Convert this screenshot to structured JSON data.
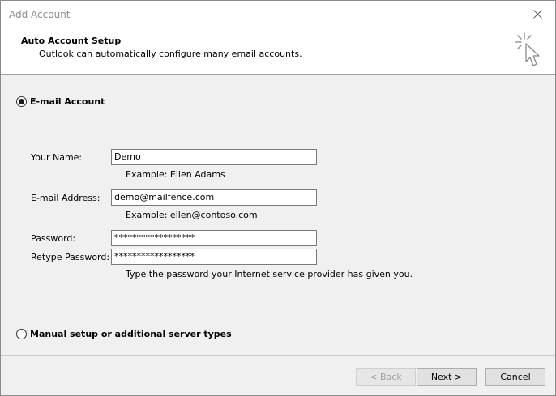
{
  "window": {
    "title": "Add Account"
  },
  "header": {
    "title": "Auto Account Setup",
    "subtitle": "Outlook can automatically configure many email accounts."
  },
  "options": {
    "email_account": {
      "label": "E-mail Account",
      "selected": true
    },
    "manual_setup": {
      "label": "Manual setup or additional server types",
      "selected": false
    }
  },
  "form": {
    "name": {
      "label": "Your Name:",
      "value": "Demo",
      "hint": "Example: Ellen Adams"
    },
    "email": {
      "label": "E-mail Address:",
      "value": "demo@mailfence.com",
      "hint": "Example: ellen@contoso.com"
    },
    "password": {
      "label": "Password:",
      "value": "******************"
    },
    "retype": {
      "label": "Retype Password:",
      "value": "******************"
    },
    "password_hint": "Type the password your Internet service provider has given you."
  },
  "buttons": {
    "back": "< Back",
    "next": "Next >",
    "cancel": "Cancel"
  },
  "icons": {
    "close": "close-icon",
    "header": "cursor-sparkle-icon"
  }
}
